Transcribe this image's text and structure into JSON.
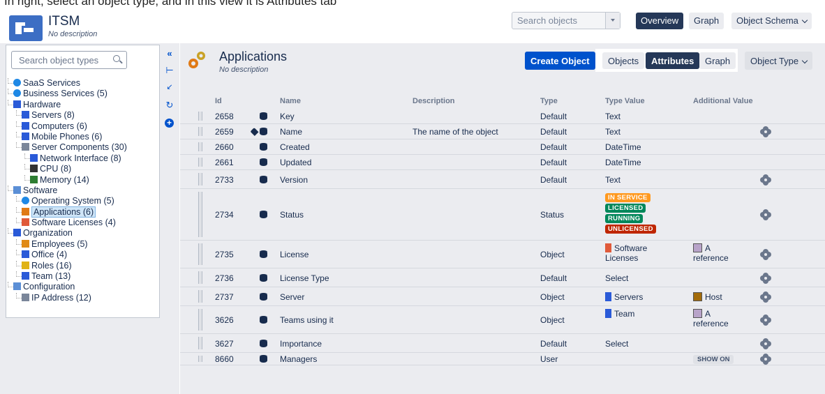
{
  "instruction_fragment": "In right, select an object type, and in this view it is Attributes tab",
  "header": {
    "title": "ITSM",
    "description": "No description",
    "search_placeholder": "Search objects",
    "overview_label": "Overview",
    "graph_label": "Graph",
    "schema_label": "Object Schema"
  },
  "sidebar": {
    "search_placeholder": "Search object types",
    "tree": [
      {
        "label": "SaaS Services",
        "icon": "saas-icon",
        "color": "#1e88e5"
      },
      {
        "label": "Business Services (5)",
        "icon": "business-services-icon",
        "color": "#1e88e5"
      },
      {
        "label": "Hardware",
        "icon": "hardware-icon",
        "color": "#2a5ad8"
      },
      {
        "label": "Servers (8)",
        "icon": "server-icon",
        "color": "#2a5ad8"
      },
      {
        "label": "Computers (6)",
        "icon": "computer-icon",
        "color": "#2a5ad8"
      },
      {
        "label": "Mobile Phones (6)",
        "icon": "mobile-phone-icon",
        "color": "#2a5ad8"
      },
      {
        "label": "Server Components (30)",
        "icon": "server-components-icon",
        "color": "#7a869a"
      },
      {
        "label": "Network Interface (8)",
        "icon": "network-interface-icon",
        "color": "#2a5ad8"
      },
      {
        "label": "CPU (8)",
        "icon": "cpu-icon",
        "color": "#333333"
      },
      {
        "label": "Memory (14)",
        "icon": "memory-icon",
        "color": "#2e7d32"
      },
      {
        "label": "Software",
        "icon": "software-icon",
        "color": "#5b8fd6"
      },
      {
        "label": "Operating System (5)",
        "icon": "operating-system-icon",
        "color": "#1e88e5"
      },
      {
        "label": "Applications (6)",
        "icon": "applications-icon",
        "color": "#e07a16"
      },
      {
        "label": "Software Licenses (4)",
        "icon": "software-licenses-icon",
        "color": "#e05a3a"
      },
      {
        "label": "Organization",
        "icon": "organization-icon",
        "color": "#2a5ad8"
      },
      {
        "label": "Employees (5)",
        "icon": "employees-icon",
        "color": "#e08a16"
      },
      {
        "label": "Office (4)",
        "icon": "office-icon",
        "color": "#2a5ad8"
      },
      {
        "label": "Roles (16)",
        "icon": "roles-icon",
        "color": "#e0b316"
      },
      {
        "label": "Team (13)",
        "icon": "team-icon",
        "color": "#2a5ad8"
      },
      {
        "label": "Configuration",
        "icon": "configuration-icon",
        "color": "#5b8fd6"
      },
      {
        "label": "IP Address (12)",
        "icon": "ip-address-icon",
        "color": "#7a869a"
      }
    ]
  },
  "main": {
    "title": "Applications",
    "description": "No description",
    "create_label": "Create Object",
    "tabs": [
      "Objects",
      "Attributes",
      "Graph"
    ],
    "object_type_label": "Object Type",
    "columns": [
      "Id",
      "Name",
      "Description",
      "Type",
      "Type Value",
      "Additional Value"
    ],
    "rows": [
      {
        "id": "2658",
        "name": "Key",
        "description": "",
        "type": "Default",
        "type_value": "Text",
        "additional": "",
        "gear": false
      },
      {
        "id": "2659",
        "name": "Name",
        "description": "The name of the object",
        "type": "Default",
        "type_value": "Text",
        "additional": "",
        "gear": true
      },
      {
        "id": "2660",
        "name": "Created",
        "description": "",
        "type": "Default",
        "type_value": "DateTime",
        "additional": "",
        "gear": false
      },
      {
        "id": "2661",
        "name": "Updated",
        "description": "",
        "type": "Default",
        "type_value": "DateTime",
        "additional": "",
        "gear": false
      },
      {
        "id": "2733",
        "name": "Version",
        "description": "",
        "type": "Default",
        "type_value": "Text",
        "additional": "",
        "gear": true
      },
      {
        "id": "2734",
        "name": "Status",
        "description": "",
        "type": "Status",
        "type_value": "",
        "additional": "",
        "gear": true
      },
      {
        "id": "2735",
        "name": "License",
        "description": "",
        "type": "Object",
        "type_value": "Software Licenses",
        "additional": "A reference",
        "gear": true
      },
      {
        "id": "2736",
        "name": "License Type",
        "description": "",
        "type": "Default",
        "type_value": "Select",
        "additional": "",
        "gear": true
      },
      {
        "id": "2737",
        "name": "Server",
        "description": "",
        "type": "Object",
        "type_value": "Servers",
        "additional": "Host",
        "gear": true
      },
      {
        "id": "3626",
        "name": "Teams using it",
        "description": "",
        "type": "Object",
        "type_value": "Team",
        "additional": "A reference",
        "gear": true
      },
      {
        "id": "3627",
        "name": "Importance",
        "description": "",
        "type": "Default",
        "type_value": "Select",
        "additional": "",
        "gear": true
      },
      {
        "id": "8660",
        "name": "Managers",
        "description": "",
        "type": "User",
        "type_value": "",
        "additional": "SHOW ON",
        "gear": true
      }
    ],
    "status_badges": [
      {
        "label": "IN SERVICE",
        "color": "#ff991f"
      },
      {
        "label": "LICENSED",
        "color": "#00875a"
      },
      {
        "label": "RUNNING",
        "color": "#00875a"
      },
      {
        "label": "UNLICENSED",
        "color": "#bf2600"
      }
    ],
    "swatch_colors": {
      "reference": "#b8a3c9",
      "host": "#a36b0a"
    }
  }
}
